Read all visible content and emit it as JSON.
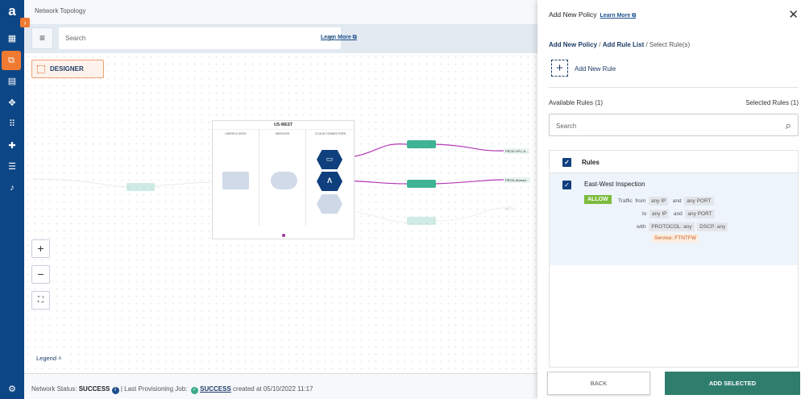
{
  "header": {
    "title": "Network Topology"
  },
  "sidebar": {
    "items": [
      {
        "icon": "dashboard-icon",
        "glyph": "▦"
      },
      {
        "icon": "topology-icon",
        "glyph": "⧉",
        "active": true
      },
      {
        "icon": "document-icon",
        "glyph": "▤"
      },
      {
        "icon": "network-icon",
        "glyph": "✥"
      },
      {
        "icon": "apps-icon",
        "glyph": "⠿"
      },
      {
        "icon": "puzzle-icon",
        "glyph": "✚"
      },
      {
        "icon": "sliders-icon",
        "glyph": "☰"
      },
      {
        "icon": "bell-icon",
        "glyph": "♪"
      },
      {
        "icon": "gear-icon",
        "glyph": "⚙"
      }
    ]
  },
  "toolbar": {
    "search_placeholder": "Search",
    "learn_more": "Learn More"
  },
  "canvas": {
    "designer_label": "DESIGNER",
    "region": {
      "title": "US-WEST",
      "columns": [
        "USERS & SITES",
        "SERVICES",
        "CLOUD CONNECTORS"
      ]
    },
    "labels": [
      "PROD-VPC-A...",
      "PROD-Ahmad...",
      "NET..."
    ],
    "legend_label": "Legend",
    "zoom_in": "+",
    "zoom_out": "−"
  },
  "footer": {
    "network_status_label": "Network Status:",
    "network_status": "SUCCESS",
    "last_job_label": "| Last Provisioning Job:",
    "last_job_status": "SUCCESS",
    "created": "created at 05/10/2022 11:17"
  },
  "panel": {
    "title": "Add New Policy",
    "learn_more": "Learn More",
    "breadcrumb": [
      "Add New Policy",
      "Add Rule List",
      "Select Rule(s)"
    ],
    "add_rule": "Add New Rule",
    "available": "Available Rules (1)",
    "selected": "Selected Rules (1)",
    "search_placeholder": "Search",
    "list_header": "Rules",
    "rule": {
      "name": "East-West Inspection",
      "action": "ALLOW",
      "traffic": "Traffic",
      "from": "from",
      "from_ip": "any IP",
      "and1": "and",
      "from_port": "any PORT",
      "to": "to",
      "to_ip": "any IP",
      "and2": "and",
      "to_port": "any PORT",
      "with": "with",
      "protocol": "PROTOCOL: any",
      "dscp": "DSCP: any",
      "service": "Service: FTNTFW"
    },
    "back": "BACK",
    "add_selected": "ADD SELECTED"
  },
  "colors": {
    "sidebar": "#0d4686",
    "accent": "#f07a32",
    "primary_button": "#2f7d6d",
    "allow": "#7cbb3c",
    "link": "#e040c8"
  }
}
